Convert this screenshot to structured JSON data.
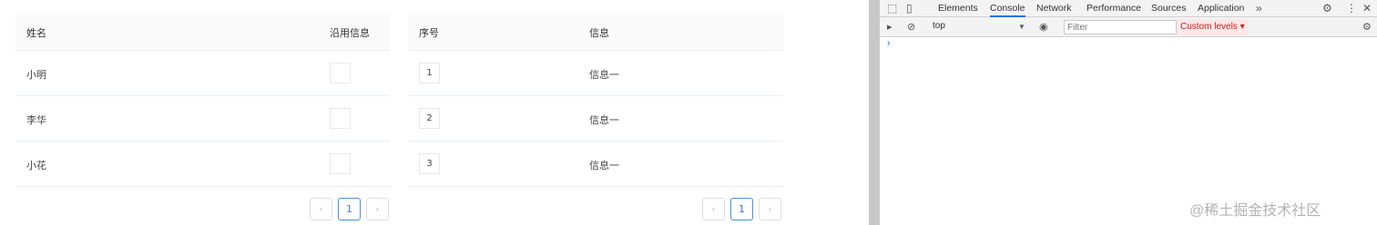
{
  "table_left": {
    "headers": {
      "name": "姓名",
      "reuse": "沿用信息"
    },
    "rows": [
      {
        "name": "小明"
      },
      {
        "name": "李华"
      },
      {
        "name": "小花"
      }
    ]
  },
  "table_right": {
    "headers": {
      "index": "序号",
      "info": "信息"
    },
    "rows": [
      {
        "index": "1",
        "info": "信息一"
      },
      {
        "index": "2",
        "info": "信息一"
      },
      {
        "index": "3",
        "info": "信息一"
      }
    ]
  },
  "pager_left": {
    "prev": "‹",
    "page": "1",
    "next": "›"
  },
  "pager_right": {
    "prev": "‹",
    "page": "1",
    "next": "›"
  },
  "devtools": {
    "tabs": [
      "Elements",
      "Console",
      "Network",
      "Performance",
      "Sources",
      "Application"
    ],
    "more": "»",
    "context": "top",
    "filter_placeholder": "Filter",
    "levels": "Custom levels ▾",
    "prompt": "›",
    "watermark": "@稀土掘金技术社区"
  }
}
